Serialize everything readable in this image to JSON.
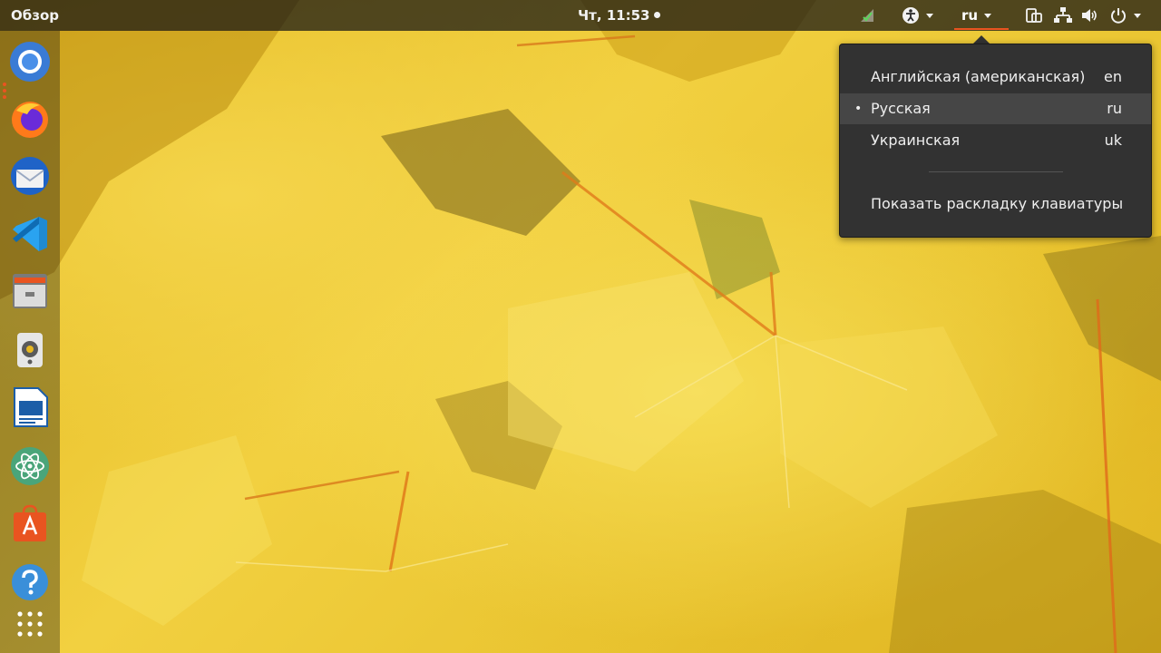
{
  "topbar": {
    "overview_label": "Обзор",
    "clock": "Чт, 11:53",
    "language_indicator": "ru"
  },
  "indicators": {
    "icons": [
      "network-check-icon",
      "accessibility-icon",
      "screen-rotation-icon",
      "wired-network-icon",
      "volume-icon",
      "power-icon"
    ]
  },
  "dock": {
    "apps": [
      {
        "name": "chromium",
        "icon": "chromium-icon",
        "running": true
      },
      {
        "name": "firefox",
        "icon": "firefox-icon",
        "running": false
      },
      {
        "name": "thunderbird",
        "icon": "thunderbird-icon",
        "running": false
      },
      {
        "name": "vscode",
        "icon": "vscode-icon",
        "running": false
      },
      {
        "name": "files",
        "icon": "files-icon",
        "running": false
      },
      {
        "name": "rhythmbox",
        "icon": "speaker-icon",
        "running": false
      },
      {
        "name": "libreoffice-writer",
        "icon": "writer-icon",
        "running": false
      },
      {
        "name": "atom",
        "icon": "atom-icon",
        "running": false
      },
      {
        "name": "software",
        "icon": "software-center-icon",
        "running": false
      },
      {
        "name": "help",
        "icon": "help-icon",
        "running": false
      },
      {
        "name": "show-applications",
        "icon": "app-grid-icon",
        "running": false
      }
    ]
  },
  "language_menu": {
    "items": [
      {
        "label": "Английская (американская)",
        "code": "en",
        "selected": false
      },
      {
        "label": "Русская",
        "code": "ru",
        "selected": true
      },
      {
        "label": "Украинская",
        "code": "uk",
        "selected": false
      }
    ],
    "bullet": "•",
    "show_layout_label": "Показать раскладку клавиатуры"
  },
  "colors": {
    "accent": "#e95420",
    "menu_bg": "#323232",
    "menu_active": "#464646",
    "topbar_bg": "#1a1a1a"
  }
}
